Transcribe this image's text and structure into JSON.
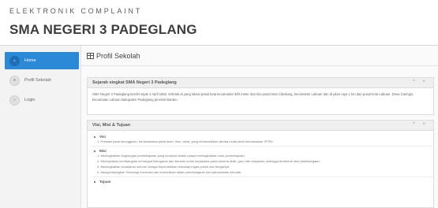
{
  "header": {
    "subtitle": "ELEKTRONIK COMPLAINT",
    "title": "SMA NEGERI 3 PADEGLANG"
  },
  "sidebar": {
    "items": [
      {
        "label": "Home",
        "icon": "home-icon",
        "active": true
      },
      {
        "label": "Profil Sekolah",
        "icon": "list-icon",
        "active": false
      },
      {
        "label": "Login",
        "icon": "login-icon",
        "active": false
      }
    ]
  },
  "page": {
    "title": "Profil Sekolah"
  },
  "history": {
    "title": "Sejarah singkat SMA Negeri 3 Padeglang",
    "tools": "^ ×",
    "body": "SMA Negeri 3 Padeglang berdiri sejak 4 April 1982. terletak di yang lokasi pusat kota kecamatan 300 meter dan kini pusat kota Cibaliung, kecamatan Labuan dan di jalan raya 1 km dari pusat kota Labuan. Desa Caringin, kecamatan Labuan kabupaten Padeglang provinsi Banten."
  },
  "vision": {
    "title": "Visi, Misi & Tujuan",
    "tools": "^ ×",
    "visi_label": "Visi",
    "visi_lines": [
      "1. Prestasi pada keunggulan, berlandaskan pada iman, ilmu, amal, yang berlandaskan akhlaq mulia serta berwawasan IPTEK"
    ],
    "misi_label": "Misi",
    "misi_lines": [
      "1. Meningkatkan tingkungan pembelajaran yang kondusif dalam upaya meningkatkan mutu pembelajaran.",
      "2. Menciptakan kembangkan semangat kebugaran dan bersatu untuk kerjasama pada peserta didik, guru dan karyawan sehingga terbentuk rasa kekeluargaan.",
      "3. Meningkatkan kesadaran seluruh tenaga kependidikan terhadap tugas pokok dan fungsinya.",
      "4. Mengembangkan Teknologi informasi dan komunikasi dalam pembelajaran dan administrasi sekolah."
    ],
    "tujuan_label": "Tujuan"
  }
}
